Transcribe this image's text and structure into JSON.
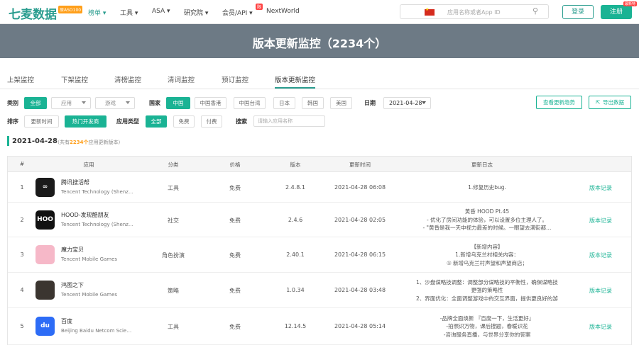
{
  "nav": {
    "logo": "七麦数据",
    "logo_badge": "原ASO100",
    "items": [
      "榜单 ▾",
      "工具 ▾",
      "ASA ▾",
      "研究院 ▾",
      "会员/API ▾",
      "NextWorld"
    ],
    "hot_badge": "限",
    "search_placeholder": "应用名称或者App ID",
    "login": "登录",
    "register": "注册",
    "register_badge": "最新特"
  },
  "banner": {
    "title": "版本更新监控（2234个）"
  },
  "tabs": [
    "上架监控",
    "下架监控",
    "清榜监控",
    "清词监控",
    "预订监控",
    "版本更新监控"
  ],
  "filters": {
    "category_label": "类别",
    "category_all": "全部",
    "category_app": "应用",
    "category_game": "游戏",
    "country_label": "国家",
    "countries": [
      "中国",
      "中国香港",
      "中国台湾",
      "日本",
      "韩国",
      "美国"
    ],
    "date_label": "日期",
    "date_value": "2021-04-28",
    "trend_button": "查看更新趋势",
    "export_button": "导出数据",
    "sort_label": "排序",
    "sort_options": [
      "更新时间",
      "热门开发商"
    ],
    "apptype_label": "应用类型",
    "apptype_options": [
      "全部",
      "免费",
      "付费"
    ],
    "search_label": "搜索",
    "search_placeholder": "请输入应用名称"
  },
  "summary": {
    "date": "2021-04-28",
    "pre": "（共有",
    "count": "2234个",
    "post": "应用更新版本）"
  },
  "table": {
    "headers": [
      "#",
      "应用",
      "分类",
      "价格",
      "版本",
      "更新时间",
      "更新日志"
    ],
    "rows": [
      {
        "idx": "1",
        "name": "腾讯搜活帮",
        "dev": "Tencent Technology (Shenz…",
        "cat": "工具",
        "price": "免费",
        "ver": "2.4.8.1",
        "time": "2021-04-28 06:08",
        "log": [
          "1.修复历史bug."
        ],
        "link": "版本记录",
        "color": "#1a1a1a",
        "glyph": "∞"
      },
      {
        "idx": "2",
        "name": "HOOD-发现酷朋友",
        "dev": "Tencent Technology (Shenz…",
        "cat": "社交",
        "price": "免费",
        "ver": "2.4.6",
        "time": "2021-04-28 02:05",
        "log": [
          "黄昏 HOOD Pt.45",
          "- 优化了房间功能的体验，可以设置多位主理人了。",
          "- \"黄昏是我一天中视力最差的时候。一眼望去满街都…"
        ],
        "link": "版本记录",
        "color": "#111",
        "glyph": "HOO"
      },
      {
        "idx": "3",
        "name": "魔力宝贝",
        "dev": "Tencent Mobile Games",
        "cat": "角色扮演",
        "price": "免费",
        "ver": "2.40.1",
        "time": "2021-04-28 06:15",
        "log": [
          "【新增内容】",
          "1.新增乌克兰村相关内容：",
          "① 新增乌克兰村声望和声望商店；"
        ],
        "link": "版本记录",
        "color": "#f6b8c8",
        "glyph": ""
      },
      {
        "idx": "4",
        "name": "鸿图之下",
        "dev": "Tencent Mobile Games",
        "cat": "策略",
        "price": "免费",
        "ver": "1.0.34",
        "time": "2021-04-28 03:48",
        "log": [
          "1、沙盘谋略技调整：调整部分谋略技的平衡性，确保谋略技体现",
          "更强的策略性",
          "2、界面优化：全面调整游戏中的交互界面，提供更良好的游戏…"
        ],
        "link": "版本记录",
        "color": "#3b3530",
        "glyph": ""
      },
      {
        "idx": "5",
        "name": "百度",
        "dev": "Beijing Baidu Netcom Scie…",
        "cat": "工具",
        "price": "免费",
        "ver": "12.14.5",
        "time": "2021-04-28 05:14",
        "log": [
          "-品牌全面焕新 『百度一下，生活更好』",
          "-拍照识万物，课后搜题，春暖识花",
          "-咨询服务直播，与世界分享你的答案"
        ],
        "link": "版本记录",
        "color": "#2d6cf6",
        "glyph": "du"
      }
    ]
  }
}
